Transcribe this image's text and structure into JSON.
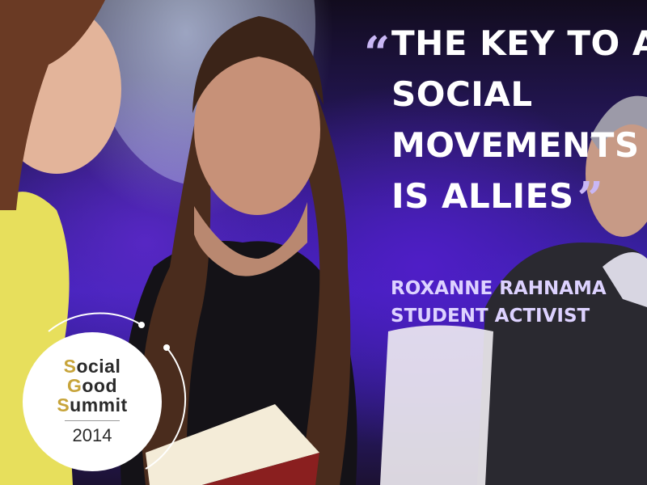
{
  "quote": {
    "open_mark": "“",
    "lines": [
      "The key to all",
      "social",
      "movements",
      "is allies"
    ],
    "close_mark": "”"
  },
  "attribution": {
    "name": "Roxanne Rahnama",
    "title": "Student Activist"
  },
  "badge": {
    "lines": [
      "Social",
      "Good",
      "Summit"
    ],
    "year": "2014"
  },
  "colors": {
    "accent_gold": "#c7a43a",
    "background_purple": "#3d22b8",
    "quote_text": "#ffffff",
    "attribution_text": "#ddd2ff"
  }
}
